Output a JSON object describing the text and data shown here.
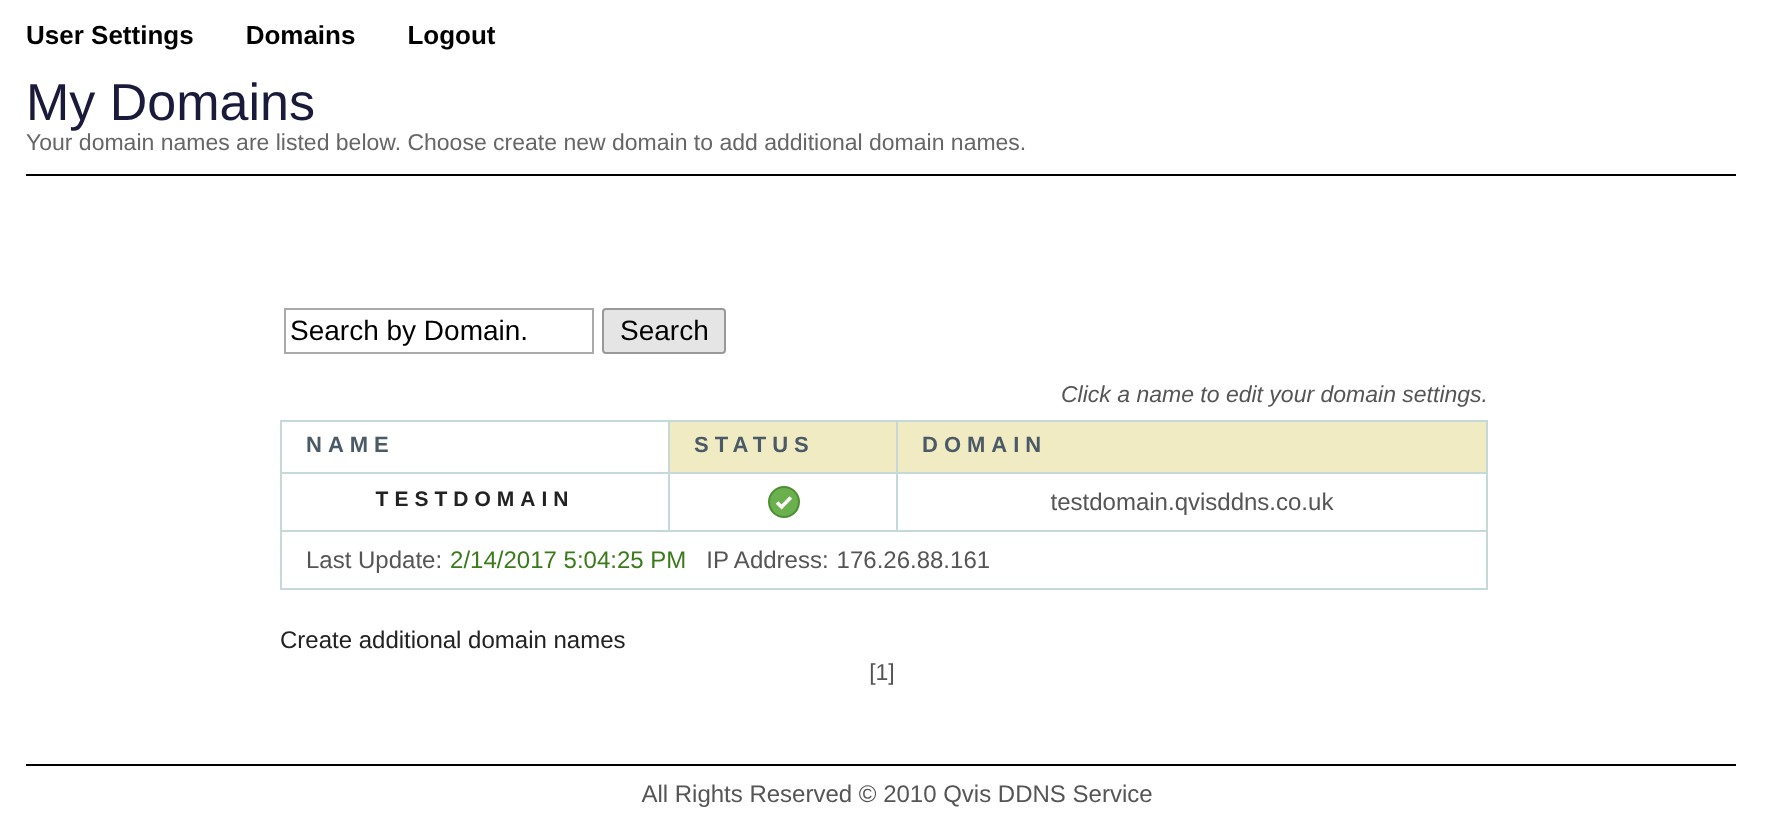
{
  "nav": [
    "User Settings",
    "Domains",
    "Logout"
  ],
  "title": "My Domains",
  "subtitle": "Your domain names are listed below. Choose create new domain to add additional domain names.",
  "search": {
    "value": "Search by Domain.",
    "button": "Search"
  },
  "hint": "Click a name to edit your domain settings.",
  "table": {
    "columns": [
      "NAME",
      "STATUS",
      "DOMAIN"
    ],
    "rows": [
      {
        "name": "TESTDOMAIN",
        "online": true,
        "domain": "testdomain.qvisddns.co.uk",
        "last_update_label": "Last Update:",
        "last_update": "2/14/2017 5:04:25 PM",
        "ip_label": "IP Address:",
        "ip": "176.26.88.161"
      }
    ]
  },
  "create_link": "Create additional domain names",
  "pager": "[1]",
  "footer": "All Rights Reserved © 2010 Qvis DDNS Service"
}
